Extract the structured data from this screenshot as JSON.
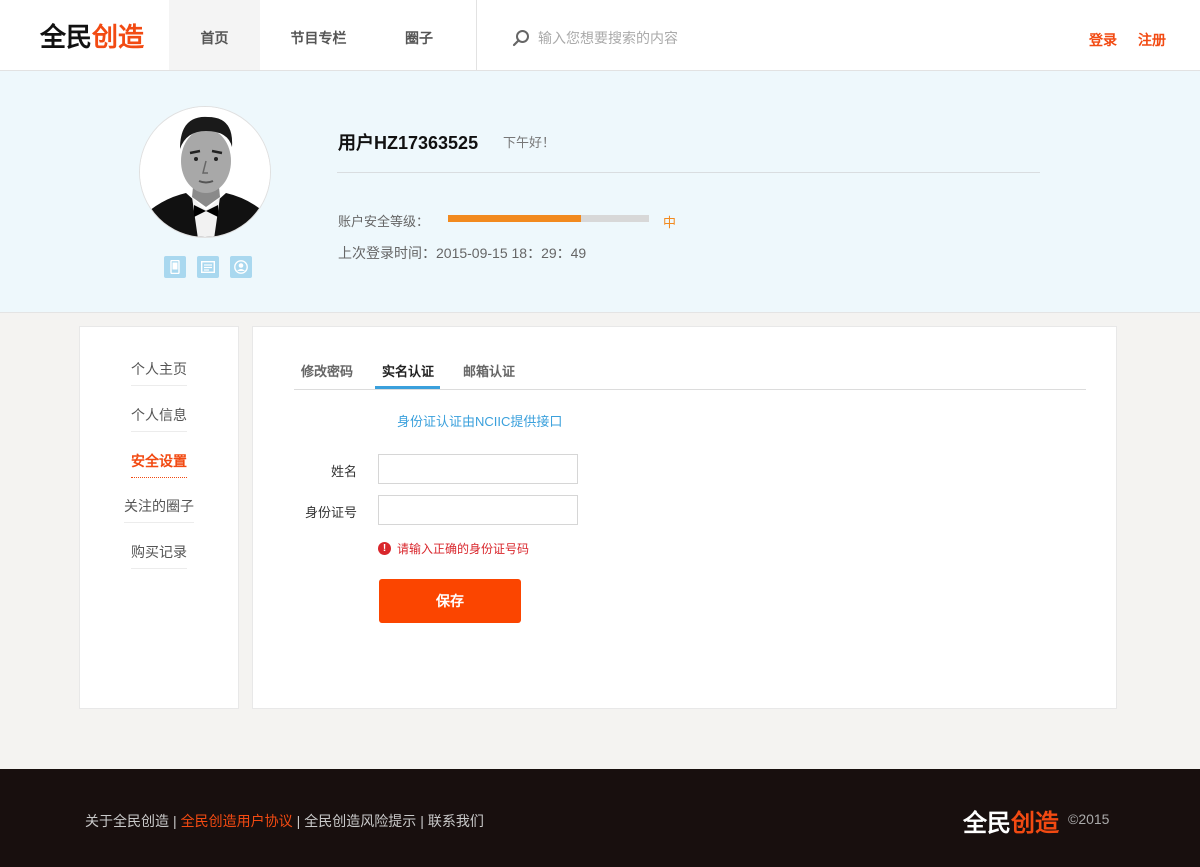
{
  "header": {
    "logo_a": "全民",
    "logo_b": "创造",
    "nav": [
      "首页",
      "节目专栏",
      "圈子"
    ],
    "search_placeholder": "输入您想要搜索的内容",
    "login": "登录",
    "register": "注册"
  },
  "profile": {
    "username": "用户HZ17363525",
    "greeting": "下午好！",
    "security_label": "账户安全等级：",
    "security_level": "中",
    "security_progress": 0.66,
    "last_login": "上次登录时间：2015-09-15 18：29：49",
    "badges": [
      "phone-icon",
      "message-icon",
      "user-icon"
    ]
  },
  "sidebar": {
    "items": [
      "个人主页",
      "个人信息",
      "安全设置",
      "关注的圈子",
      "购买记录"
    ],
    "active": "安全设置"
  },
  "main": {
    "tabs": [
      "修改密码",
      "实名认证",
      "邮箱认证"
    ],
    "active_tab": "实名认证",
    "ncic_note": "身份证认证由NCIIC提供接口",
    "name_label": "姓名",
    "name_value": "",
    "id_label": "身份证号",
    "id_value": "",
    "error": "请输入正确的身份证号码",
    "save": "保存"
  },
  "footer": {
    "links": [
      "关于全民创造",
      "全民创造用户协议",
      "全民创造风险提示",
      "联系我们"
    ],
    "highlight_link": "全民创造用户协议",
    "logo_a": "全民",
    "logo_b": "创造",
    "copyright": "©2015"
  },
  "colors": {
    "brand": "#f24a12",
    "accent_blue": "#3aa0dc",
    "progress": "#f28a1f",
    "save_button": "#fb4500"
  }
}
